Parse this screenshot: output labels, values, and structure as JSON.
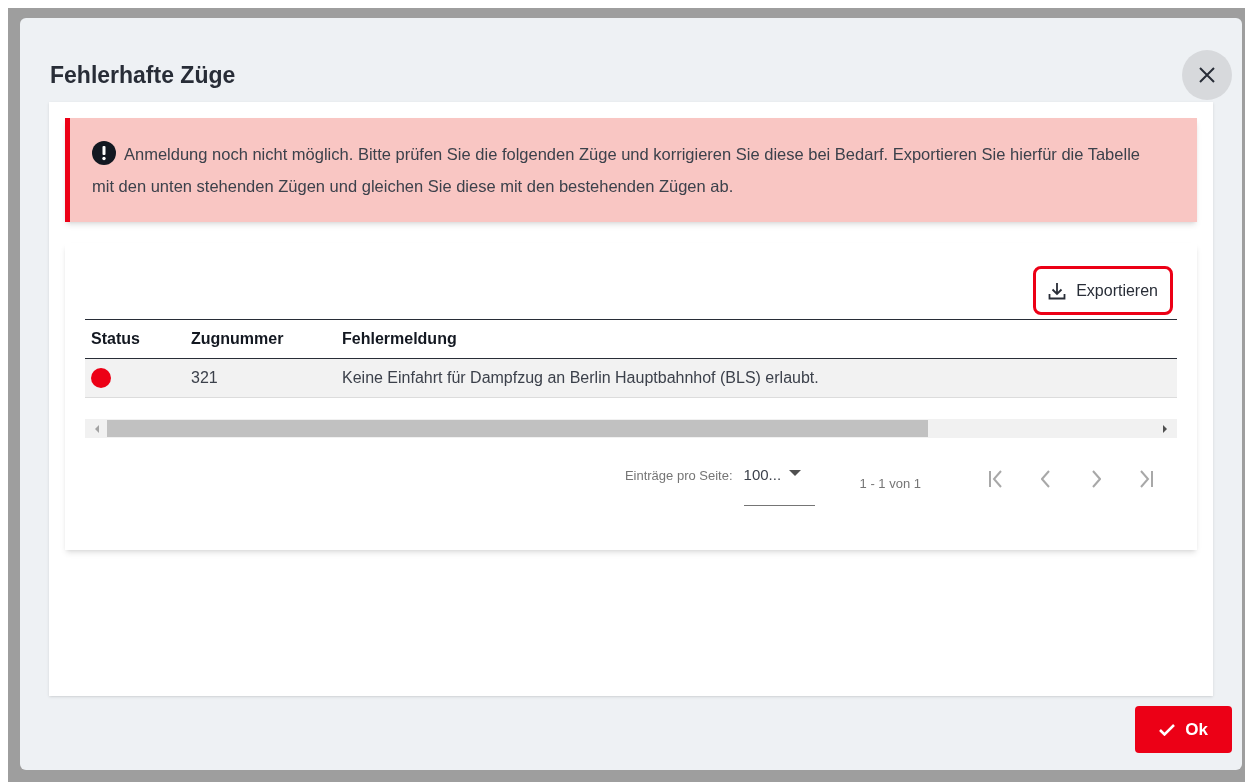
{
  "dialog": {
    "title": "Fehlerhafte Züge"
  },
  "alert": {
    "text": "Anmeldung noch nicht möglich. Bitte prüfen Sie die folgenden Züge und korrigieren Sie diese bei Bedarf. Exportieren Sie hierfür die Tabelle mit den unten stehenden Zügen und gleichen Sie diese mit den bestehenden Zügen ab."
  },
  "export_button": {
    "label": "Exportieren"
  },
  "table": {
    "columns": [
      "Status",
      "Zugnummer",
      "Fehlermeldung"
    ],
    "rows": [
      {
        "color": "#ec0016",
        "zugnummer": "321",
        "fehlermeldung": "Keine Einfahrt für Dampfzug an Berlin Hauptbahnhof (BLS) erlaubt."
      }
    ]
  },
  "pagination": {
    "page_size_label": "Einträge pro Seite:",
    "page_size": "100...",
    "range": "1 - 1 von 1"
  },
  "ok_button": {
    "label": "Ok"
  }
}
